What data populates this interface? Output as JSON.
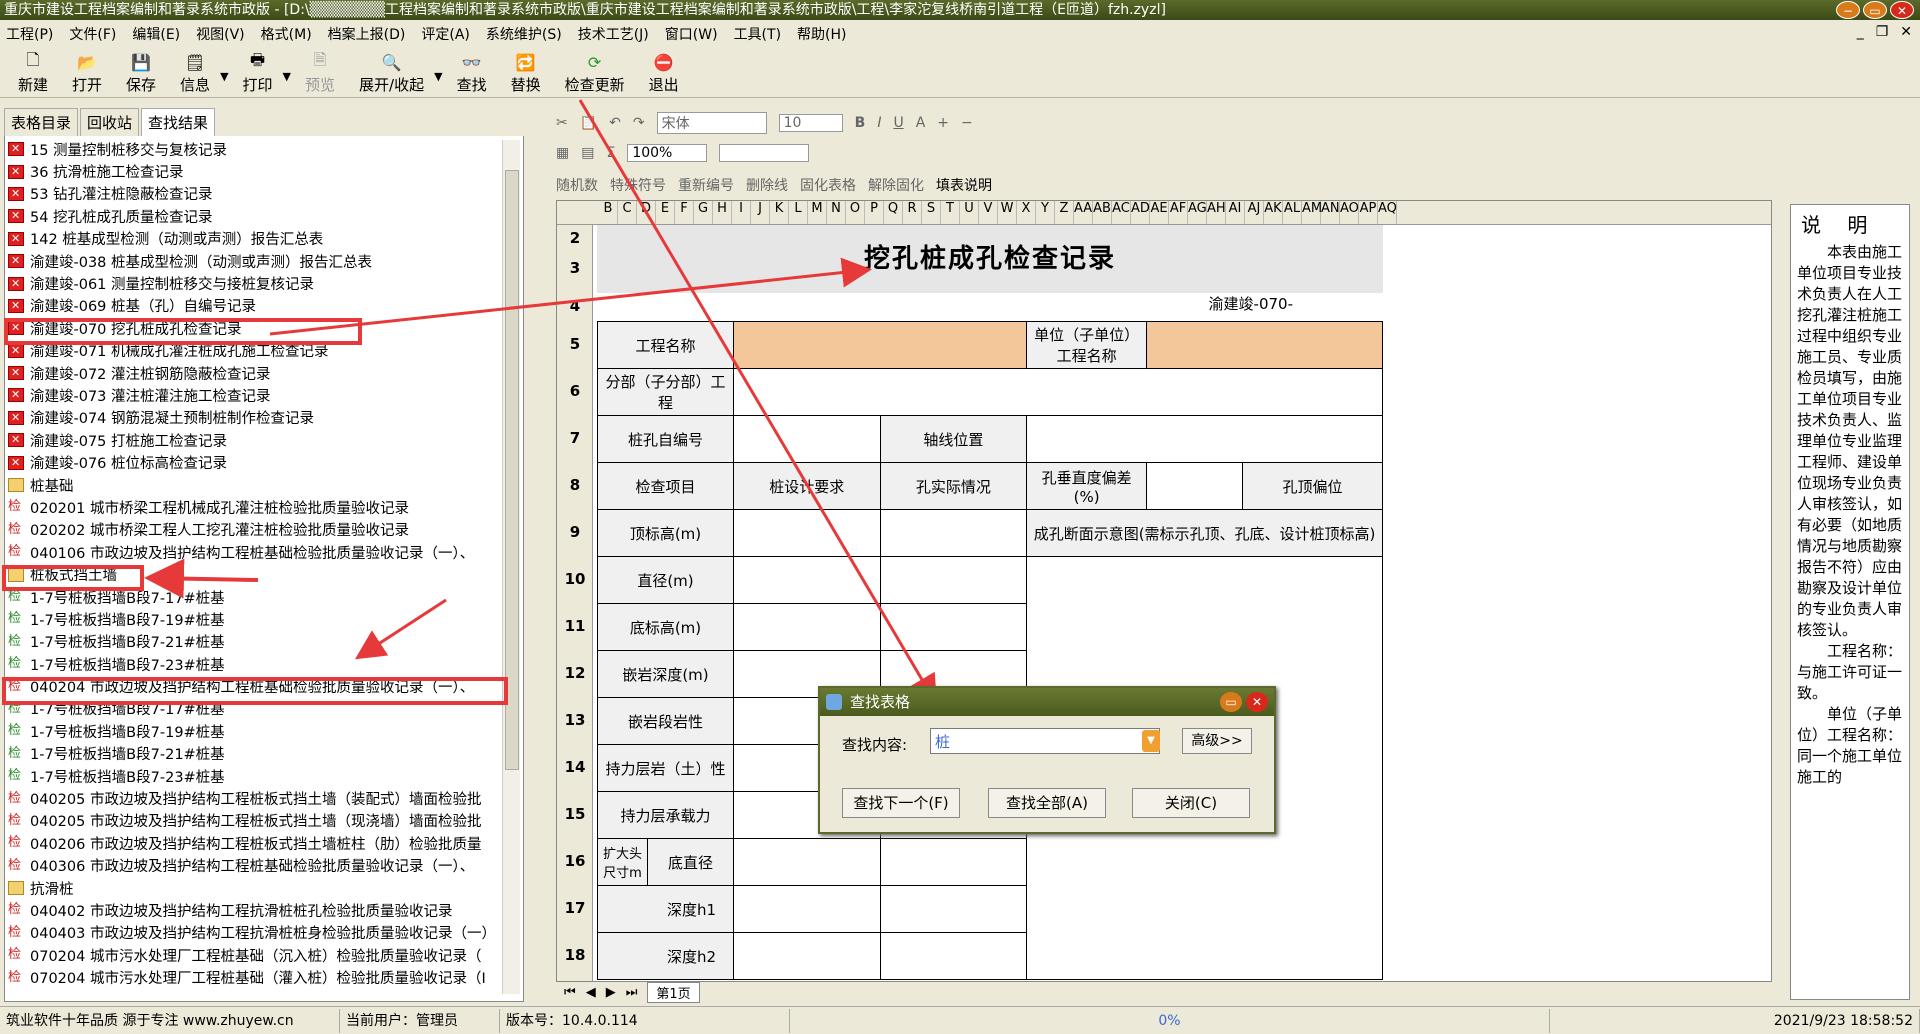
{
  "window": {
    "title": "重庆市建设工程档案编制和著录系统市政版 - [D:\\▒▒▒▒▒▒▒工程档案编制和著录系统市政版\\重庆市建设工程档案编制和著录系统市政版\\工程\\李家沱复线桥南引道工程（E匝道）fzh.zyzl]"
  },
  "menu": [
    "工程(P)",
    "文件(F)",
    "编辑(E)",
    "视图(V)",
    "格式(M)",
    "档案上报(D)",
    "评定(A)",
    "系统维护(S)",
    "技术工艺(J)",
    "窗口(W)",
    "工具(T)",
    "帮助(H)"
  ],
  "toolbar": {
    "new": "新建",
    "open": "打开",
    "save": "保存",
    "info": "信息",
    "print": "打印",
    "preview": "预览",
    "expand": "展开/收起",
    "find": "查找",
    "replace": "替换",
    "check": "检查更新",
    "exit": "退出"
  },
  "tabs": [
    "表格目录",
    "回收站",
    "查找结果"
  ],
  "tree": [
    {
      "t": "red",
      "text": "15 测量控制桩移交与复核记录"
    },
    {
      "t": "red",
      "text": "36 抗滑桩施工检查记录"
    },
    {
      "t": "red",
      "text": "53 钻孔灌注桩隐蔽检查记录"
    },
    {
      "t": "red",
      "text": "54 挖孔桩成孔质量检查记录"
    },
    {
      "t": "red",
      "text": "142 桩基成型检测（动测或声测）报告汇总表"
    },
    {
      "t": "red",
      "text": "渝建竣-038 桩基成型检测（动测或声测）报告汇总表"
    },
    {
      "t": "red",
      "text": "渝建竣-061 测量控制桩移交与接桩复核记录"
    },
    {
      "t": "red",
      "text": "渝建竣-069 桩基（孔）自编号记录"
    },
    {
      "t": "red",
      "text": "渝建竣-070 挖孔桩成孔检查记录"
    },
    {
      "t": "red",
      "text": "渝建竣-071 机械成孔灌注桩成孔施工检查记录"
    },
    {
      "t": "red",
      "text": "渝建竣-072 灌注桩钢筋隐蔽检查记录"
    },
    {
      "t": "red",
      "text": "渝建竣-073 灌注桩灌注施工检查记录"
    },
    {
      "t": "red",
      "text": "渝建竣-074 钢筋混凝土预制桩制作检查记录"
    },
    {
      "t": "red",
      "text": "渝建竣-075 打桩施工检查记录"
    },
    {
      "t": "red",
      "text": "渝建竣-076 桩位标高检查记录"
    },
    {
      "t": "folder",
      "text": "桩基础"
    },
    {
      "t": "chk",
      "text": "020201 城市桥梁工程机械成孔灌注桩检验批质量验收记录"
    },
    {
      "t": "chk",
      "text": "020202 城市桥梁工程人工挖孔灌注桩检验批质量验收记录"
    },
    {
      "t": "chk",
      "text": "040106 市政边坡及挡护结构工程桩基础检验批质量验收记录（一）、"
    },
    {
      "t": "folder",
      "text": "桩板式挡土墙"
    },
    {
      "t": "chkg",
      "text": "1-7号桩板挡墙B段7-17#桩基"
    },
    {
      "t": "chkg",
      "text": "1-7号桩板挡墙B段7-19#桩基"
    },
    {
      "t": "chkg",
      "text": "1-7号桩板挡墙B段7-21#桩基"
    },
    {
      "t": "chkg",
      "text": "1-7号桩板挡墙B段7-23#桩基"
    },
    {
      "t": "chk",
      "text": "040204 市政边坡及挡护结构工程桩基础检验批质量验收记录（一）、"
    },
    {
      "t": "chkg",
      "text": "1-7号桩板挡墙B段7-17#桩基"
    },
    {
      "t": "chkg",
      "text": "1-7号桩板挡墙B段7-19#桩基"
    },
    {
      "t": "chkg",
      "text": "1-7号桩板挡墙B段7-21#桩基"
    },
    {
      "t": "chkg",
      "text": "1-7号桩板挡墙B段7-23#桩基"
    },
    {
      "t": "chk",
      "text": "040205 市政边坡及挡护结构工程桩板式挡土墙（装配式）墙面检验批"
    },
    {
      "t": "chk",
      "text": "040205 市政边坡及挡护结构工程桩板式挡土墙（现浇墙）墙面检验批"
    },
    {
      "t": "chk",
      "text": "040206 市政边坡及挡护结构工程桩板式挡土墙桩柱（肋）检验批质量"
    },
    {
      "t": "chk",
      "text": "040306 市政边坡及挡护结构工程桩基础检验批质量验收记录（一）、"
    },
    {
      "t": "folder",
      "text": "抗滑桩"
    },
    {
      "t": "chk",
      "text": "040402 市政边坡及挡护结构工程抗滑桩桩孔检验批质量验收记录"
    },
    {
      "t": "chk",
      "text": "040403 市政边坡及挡护结构工程抗滑桩桩身检验批质量验收记录（一）"
    },
    {
      "t": "chk",
      "text": "070204 城市污水处理厂工程桩基础（沉入桩）检验批质量验收记录（"
    },
    {
      "t": "chk",
      "text": "070204 城市污水处理厂工程桩基础（灌入桩）检验批质量验收记录（I"
    }
  ],
  "chk_label": "检",
  "fmt": {
    "tb1": "随机数",
    "tb2": "特殊符号",
    "tb3": "重新编号",
    "tb4": "删除线",
    "tb5": "固化表格",
    "tb6": "解除固化",
    "tb7": "填表说明",
    "font": "宋体",
    "size": "10",
    "zoom": "100%"
  },
  "columns": [
    "B",
    "C",
    "D",
    "E",
    "F",
    "G",
    "H",
    "I",
    "J",
    "K",
    "L",
    "M",
    "N",
    "O",
    "P",
    "Q",
    "R",
    "S",
    "T",
    "U",
    "V",
    "W",
    "X",
    "Y",
    "Z",
    "AA",
    "AB",
    "AC",
    "AD",
    "AE",
    "AF",
    "AG",
    "AH",
    "AI",
    "AJ",
    "AK",
    "AL",
    "AM",
    "AN",
    "AO",
    "AP",
    "AQ"
  ],
  "rows": [
    "2",
    "3",
    "4",
    "5",
    "6",
    "7",
    "8",
    "9",
    "10",
    "11",
    "12",
    "13",
    "14",
    "15",
    "16",
    "17",
    "18"
  ],
  "form": {
    "title": "挖孔桩成孔检查记录",
    "code": "渝建竣-070-",
    "project_name": "工程名称",
    "unit": "单位（子单位）工程名称",
    "subproject": "分部（子分部）工程",
    "pile_no": "桩孔自编号",
    "axis": "轴线位置",
    "check_item": "检查项目",
    "design": "桩设计要求",
    "actual": "孔实际情况",
    "verticality": "孔垂直度偏差(%)",
    "top_offset": "孔顶偏位",
    "top_elev": "顶标高(m)",
    "section": "成孔断面示意图(需标示孔顶、孔底、设计桩顶标高)",
    "diameter": "直径(m)",
    "bottom_elev": "底标高(m)",
    "rock_depth": "嵌岩深度(m)",
    "rock_type": "嵌岩段岩性",
    "bearing_rock": "持力层岩（土）性",
    "bearing_cap": "持力层承载力",
    "enlarged": "扩大头尺寸m",
    "bottom_dia": "底直径",
    "depth1": "深度h1",
    "depth2": "深度h2"
  },
  "sheet_tab": "第1页",
  "notes": {
    "title": "说 明",
    "p1": "本表由施工单位项目专业技术负责人在人工挖孔灌注桩施工过程中组织专业施工员、专业质检员填写，由施工单位项目专业技术负责人、监理单位专业监理工程师、建设单位现场专业负责人审核签认，如有必要（如地质情况与地质勘察报告不符）应由勘察及设计单位的专业负责人审核签认。",
    "p2": "工程名称：与施工许可证一致。",
    "p3": "单位（子单位）工程名称：同一个施工单位施工的"
  },
  "dialog": {
    "title": "查找表格",
    "label": "查找内容:",
    "value": "桩",
    "advanced": "高级>>",
    "next": "查找下一个(F)",
    "all": "查找全部(A)",
    "close": "关闭(C)"
  },
  "status": {
    "s1": "筑业软件十年品质 源于专注 www.zhuyew.cn",
    "s2": "当前用户：管理员",
    "s3": "版本号：10.4.0.114",
    "progress": "0%",
    "datetime": "2021/9/23 18:58:52"
  }
}
